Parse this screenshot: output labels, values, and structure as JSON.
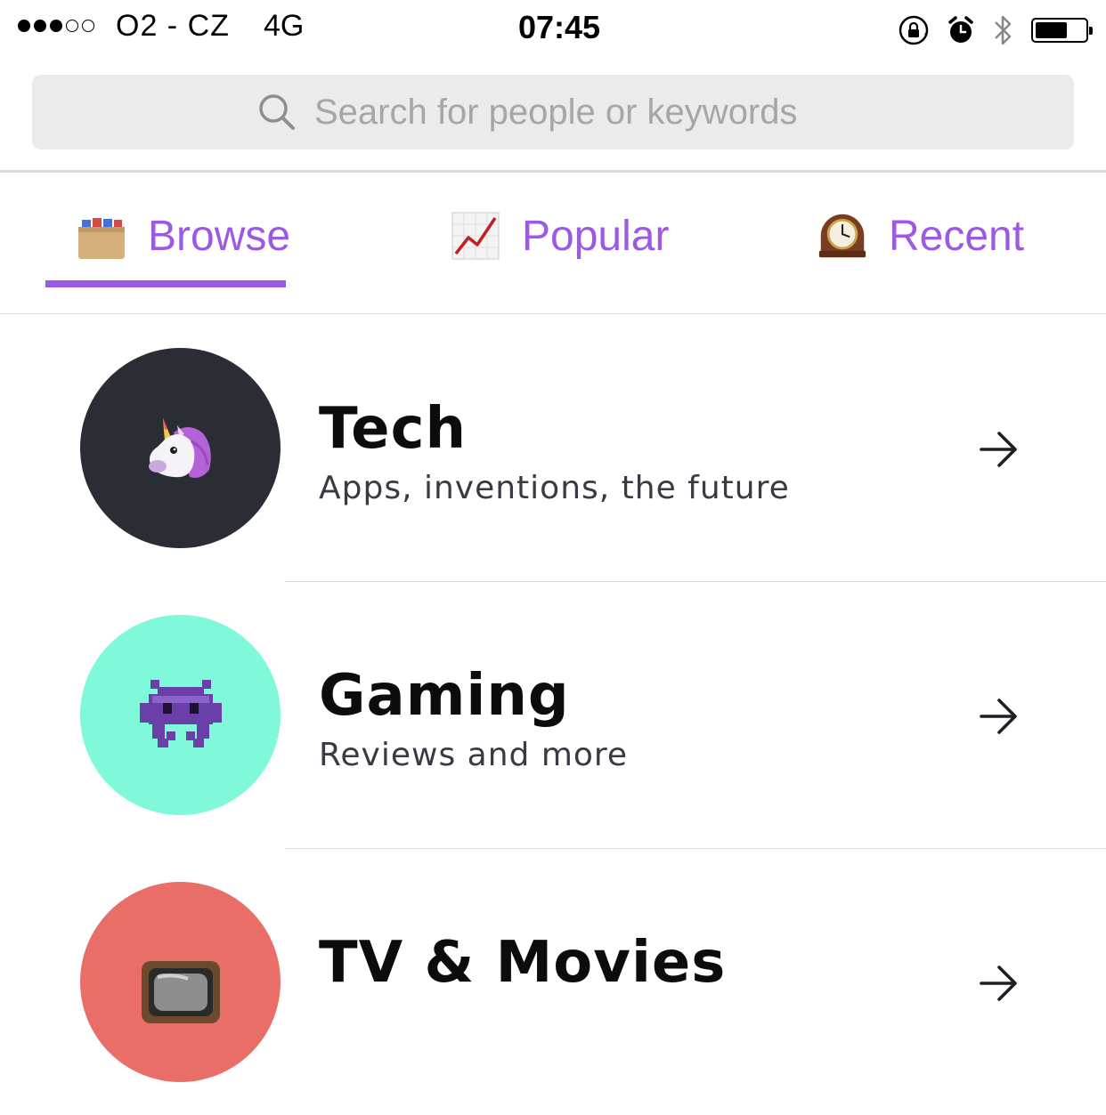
{
  "status_bar": {
    "carrier": "O2 - CZ",
    "network": "4G",
    "time": "07:45",
    "signal_bars_filled": 3,
    "signal_bars_total": 5,
    "battery_level": 0.65
  },
  "search": {
    "placeholder": "Search for people or keywords",
    "icon": "search-icon"
  },
  "tabs": [
    {
      "label": "Browse",
      "icon": "card-file-box-icon",
      "selected": true
    },
    {
      "label": "Popular",
      "icon": "chart-increasing-icon",
      "selected": false
    },
    {
      "label": "Recent",
      "icon": "mantelpiece-clock-icon",
      "selected": false
    }
  ],
  "categories": [
    {
      "title": "Tech",
      "subtitle": "Apps, inventions, the future",
      "icon": "unicorn-icon",
      "color": "#2a2d33"
    },
    {
      "title": "Gaming",
      "subtitle": "Reviews and more",
      "icon": "alien-monster-icon",
      "color": "#7ff9da"
    },
    {
      "title": "TV & Movies",
      "subtitle": "",
      "icon": "television-icon",
      "color": "#ea6e68"
    }
  ],
  "colors": {
    "accent": "#9b59e6",
    "search_bg": "#ebebeb"
  }
}
